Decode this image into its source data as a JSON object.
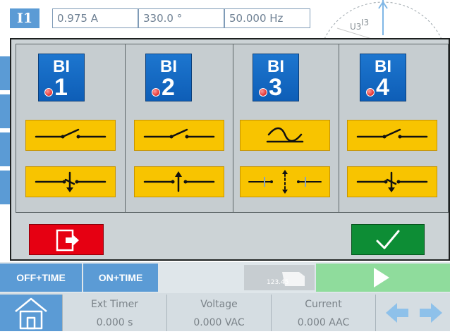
{
  "header": {
    "channel": "I1",
    "amplitude": "0.975 A",
    "phase": "330.0 °",
    "frequency": "50.000 Hz",
    "vector_labels": [
      "U3",
      "I3"
    ]
  },
  "dialog": {
    "inputs": [
      {
        "top": "BI",
        "number": "1",
        "mode": "contact-normally-open",
        "trigger": "edge-falling"
      },
      {
        "top": "BI",
        "number": "2",
        "mode": "contact-normally-open",
        "trigger": "edge-rising"
      },
      {
        "top": "BI",
        "number": "3",
        "mode": "voltage-ac",
        "trigger": "edge-both"
      },
      {
        "top": "BI",
        "number": "4",
        "mode": "contact-normally-open",
        "trigger": "edge-falling"
      }
    ],
    "exit_icon": "exit-icon",
    "ok_icon": "checkmark-icon"
  },
  "toolbar": {
    "off_time": "OFF+TIME",
    "on_time": "ON+TIME",
    "keypad_value": "123.45",
    "play_icon": "play-icon"
  },
  "status": {
    "home_icon": "home-icon",
    "cells": [
      {
        "label": "Ext Timer",
        "value": "0.000 s"
      },
      {
        "label": "Voltage",
        "value": "0.000 VAC"
      },
      {
        "label": "Current",
        "value": "0.000 AAC"
      }
    ]
  },
  "colors": {
    "accent_blue": "#5b9bd5",
    "bi_blue": "#1d76cf",
    "mode_yellow": "#f8c400",
    "exit_red": "#e60012",
    "ok_green": "#0d8d35",
    "dialog_gray": "#ccd3d6"
  }
}
